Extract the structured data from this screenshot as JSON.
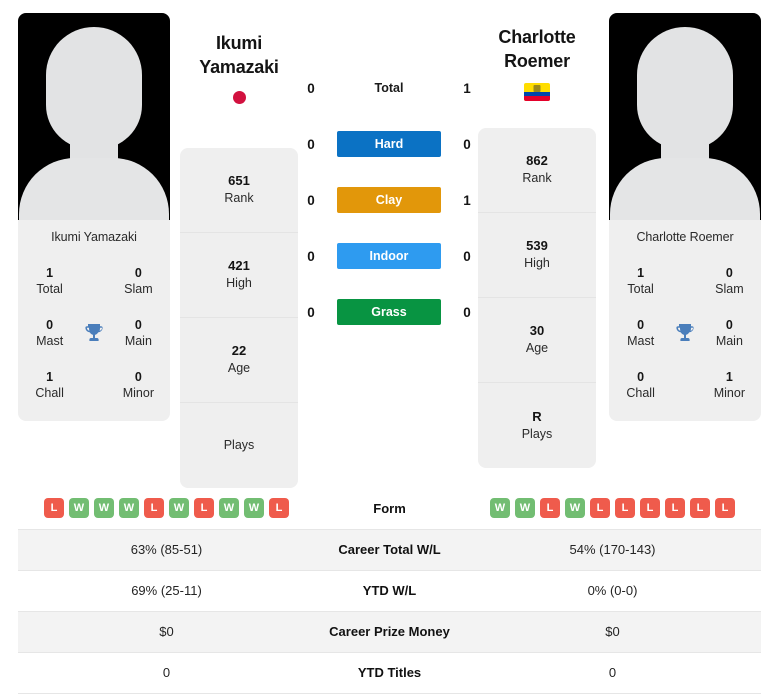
{
  "players": {
    "left": {
      "name": "Ikumi Yamazaki",
      "first_name": "Ikumi",
      "last_name": "Yamazaki",
      "flag": "japan-flag",
      "flag_country": "Japan",
      "titles": {
        "total_value": "1",
        "total_label": "Total",
        "slam_value": "0",
        "slam_label": "Slam",
        "mast_value": "0",
        "mast_label": "Mast",
        "main_value": "0",
        "main_label": "Main",
        "chall_value": "1",
        "chall_label": "Chall",
        "minor_value": "0",
        "minor_label": "Minor"
      },
      "profile": {
        "rank_value": "651",
        "rank_label": "Rank",
        "high_value": "421",
        "high_label": "High",
        "age_value": "22",
        "age_label": "Age",
        "plays_value": "",
        "plays_label": "Plays"
      },
      "form": [
        "L",
        "W",
        "W",
        "W",
        "L",
        "W",
        "L",
        "W",
        "W",
        "L"
      ],
      "career_total_wl": "63% (85-51)",
      "ytd_wl": "69% (25-11)",
      "career_prize_money": "$0",
      "ytd_titles": "0"
    },
    "right": {
      "name": "Charlotte Roemer",
      "first_name": "Charlotte",
      "last_name": "Roemer",
      "flag": "ecuador-flag",
      "flag_country": "Ecuador",
      "titles": {
        "total_value": "1",
        "total_label": "Total",
        "slam_value": "0",
        "slam_label": "Slam",
        "mast_value": "0",
        "mast_label": "Mast",
        "main_value": "0",
        "main_label": "Main",
        "chall_value": "0",
        "chall_label": "Chall",
        "minor_value": "1",
        "minor_label": "Minor"
      },
      "profile": {
        "rank_value": "862",
        "rank_label": "Rank",
        "high_value": "539",
        "high_label": "High",
        "age_value": "30",
        "age_label": "Age",
        "plays_value": "R",
        "plays_label": "Plays"
      },
      "form": [
        "W",
        "W",
        "L",
        "W",
        "L",
        "L",
        "L",
        "L",
        "L",
        "L"
      ],
      "career_total_wl": "54% (170-143)",
      "ytd_wl": "0% (0-0)",
      "career_prize_money": "$0",
      "ytd_titles": "0"
    }
  },
  "head_to_head": [
    {
      "label": "Total",
      "left": "0",
      "right": "1",
      "style": "plain",
      "color": ""
    },
    {
      "label": "Hard",
      "left": "0",
      "right": "0",
      "style": "chip",
      "color": "#0b72c4"
    },
    {
      "label": "Clay",
      "left": "0",
      "right": "1",
      "style": "chip",
      "color": "#e2970a"
    },
    {
      "label": "Indoor",
      "left": "0",
      "right": "0",
      "style": "chip",
      "color": "#2e9bf0"
    },
    {
      "label": "Grass",
      "left": "0",
      "right": "0",
      "style": "chip",
      "color": "#089442"
    }
  ],
  "table_labels": {
    "form": "Form",
    "career_total_wl": "Career Total W/L",
    "ytd_wl": "YTD W/L",
    "career_prize_money": "Career Prize Money",
    "ytd_titles": "YTD Titles"
  },
  "colors": {
    "win_badge": "#72bd72",
    "loss_badge": "#ef5b4c",
    "card_bg": "#efefef",
    "trophy": "#4a7ebb"
  }
}
